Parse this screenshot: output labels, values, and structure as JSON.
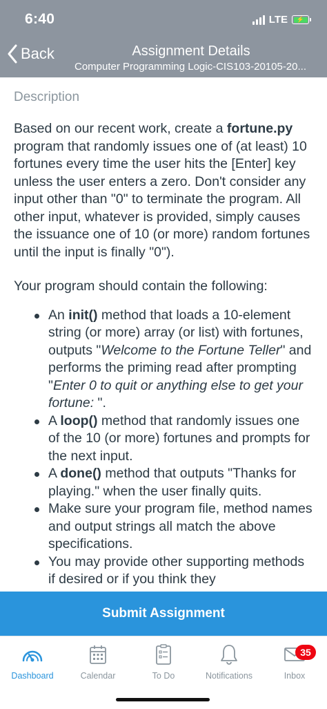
{
  "status_bar": {
    "time": "6:40",
    "network": "LTE"
  },
  "nav": {
    "back_label": "Back",
    "title": "Assignment Details",
    "subtitle": "Computer Programming Logic-CIS103-20105-20..."
  },
  "content": {
    "section_label": "Description",
    "intro": {
      "before_bold": "Based on our recent work, create a ",
      "bold": "fortune.py",
      "after_bold": " program that randomly issues one of (at least) 10 fortunes every time the user hits the [Enter] key unless the user enters a zero.  Don't consider any input other than \"0\" to terminate the program.  All other input, whatever is provided, simply causes the issuance one of 10 (or more) random fortunes until the input is finally \"0\")."
    },
    "lead_in": "Your program should contain the following:",
    "bullets": [
      {
        "pre": "An ",
        "bold": "init()",
        "text": " method that loads a 10-element string (or more) array (or list) with fortunes, outputs \"",
        "italic": "Welcome to the Fortune Teller",
        "text2": "\" and performs the priming read after prompting \"",
        "italic2": "Enter 0 to quit or anything else to get your fortune: ",
        "text3": "\"."
      },
      {
        "pre": "A ",
        "bold": "loop()",
        "text": " method that randomly issues one of the 10 (or more) fortunes and prompts for the next input."
      },
      {
        "pre": "A ",
        "bold": "done()",
        "text": " method that outputs \"Thanks for playing.\" when the user finally quits."
      },
      {
        "text": "Make sure your program file, method names and output strings all match the above specifications."
      },
      {
        "text": "You may provide other supporting methods if desired or if you think they"
      }
    ]
  },
  "submit_label": "Submit Assignment",
  "tabs": [
    {
      "label": "Dashboard",
      "icon": "dashboard-gauge-icon",
      "active": true
    },
    {
      "label": "Calendar",
      "icon": "calendar-icon",
      "active": false
    },
    {
      "label": "To Do",
      "icon": "todo-clipboard-icon",
      "active": false
    },
    {
      "label": "Notifications",
      "icon": "bell-icon",
      "active": false
    },
    {
      "label": "Inbox",
      "icon": "envelope-icon",
      "active": false,
      "badge": "35"
    }
  ],
  "colors": {
    "header_bg": "#8d959f",
    "accent": "#2a94dc",
    "badge": "#ee0612",
    "text": "#2d3b45",
    "muted": "#8b969e",
    "battery": "#4cd964"
  }
}
